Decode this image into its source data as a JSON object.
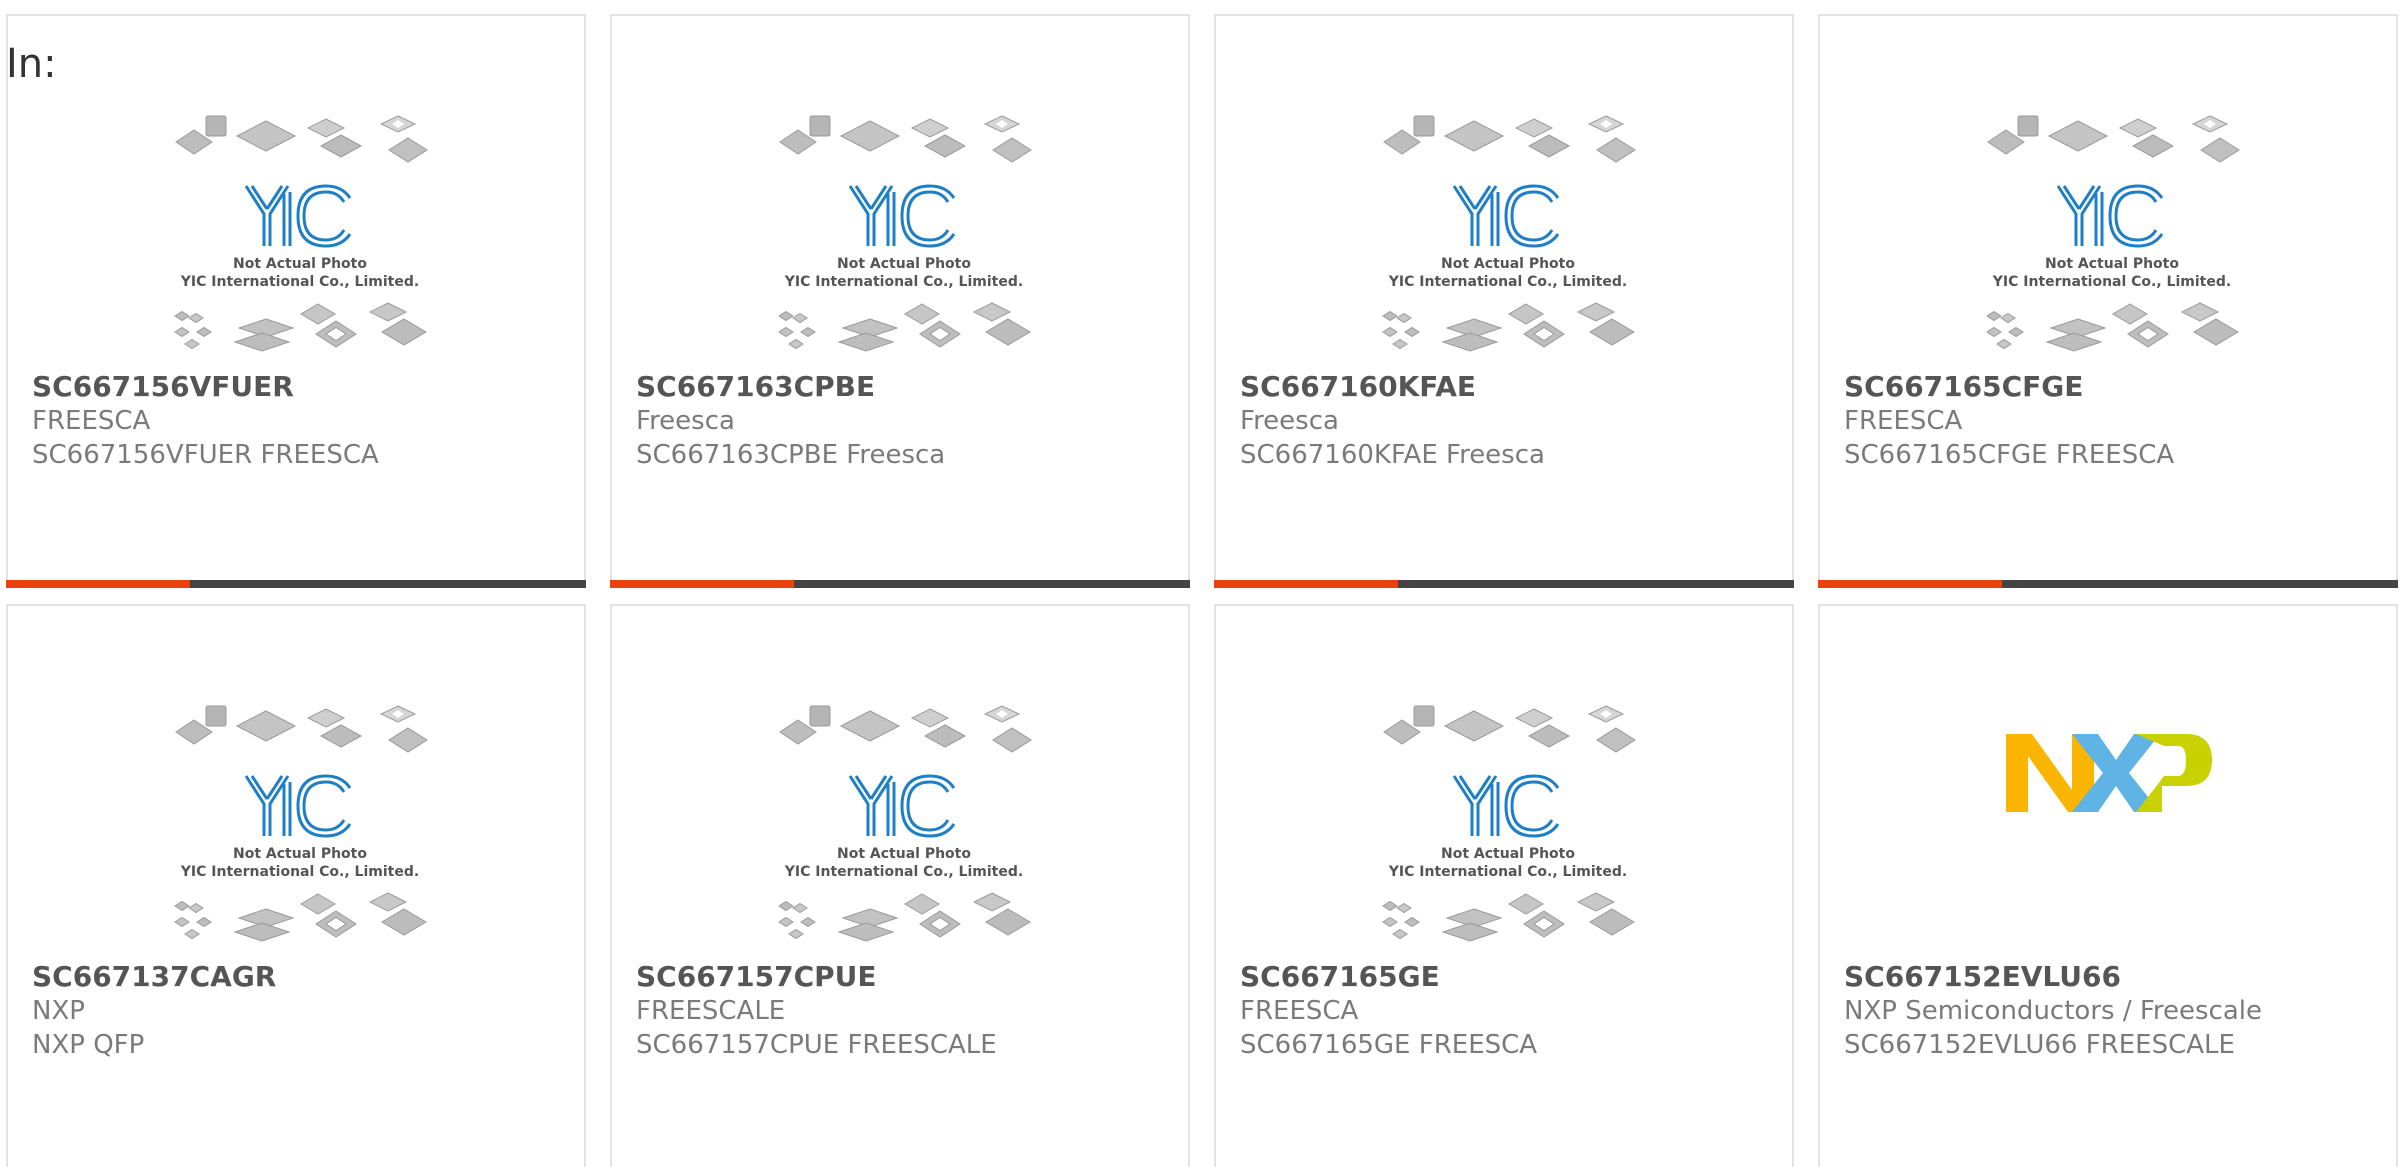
{
  "header": {
    "in_label": "In:"
  },
  "placeholder_image": {
    "caption_line1": "Not Actual Photo",
    "caption_line2": "YIC International Co., Limited.",
    "logo_text": "YIC"
  },
  "colors": {
    "accent_orange": "#e8410b",
    "accent_dark": "#444444",
    "yic_blue": "#1f7fc4",
    "nxp_orange": "#f9b500",
    "nxp_blue": "#5fb4e5",
    "nxp_green": "#c9d200"
  },
  "cards": [
    {
      "part_number": "SC667156VFUER",
      "manufacturer": "FREESCA",
      "description": "SC667156VFUER FREESCA",
      "image": "yic-placeholder"
    },
    {
      "part_number": "SC667163CPBE",
      "manufacturer": "Freesca",
      "description": "SC667163CPBE Freesca",
      "image": "yic-placeholder"
    },
    {
      "part_number": "SC667160KFAE",
      "manufacturer": "Freesca",
      "description": "SC667160KFAE Freesca",
      "image": "yic-placeholder"
    },
    {
      "part_number": "SC667165CFGE",
      "manufacturer": "FREESCA",
      "description": "SC667165CFGE FREESCA",
      "image": "yic-placeholder"
    },
    {
      "part_number": "SC667137CAGR",
      "manufacturer": "NXP",
      "description": "NXP QFP",
      "image": "yic-placeholder"
    },
    {
      "part_number": "SC667157CPUE",
      "manufacturer": "FREESCALE",
      "description": "SC667157CPUE FREESCALE",
      "image": "yic-placeholder"
    },
    {
      "part_number": "SC667165GE",
      "manufacturer": "FREESCA",
      "description": "SC667165GE FREESCA",
      "image": "yic-placeholder"
    },
    {
      "part_number": "SC667152EVLU66",
      "manufacturer": "NXP Semiconductors / Freescale",
      "description": "SC667152EVLU66 FREESCALE",
      "image": "nxp-logo"
    }
  ]
}
